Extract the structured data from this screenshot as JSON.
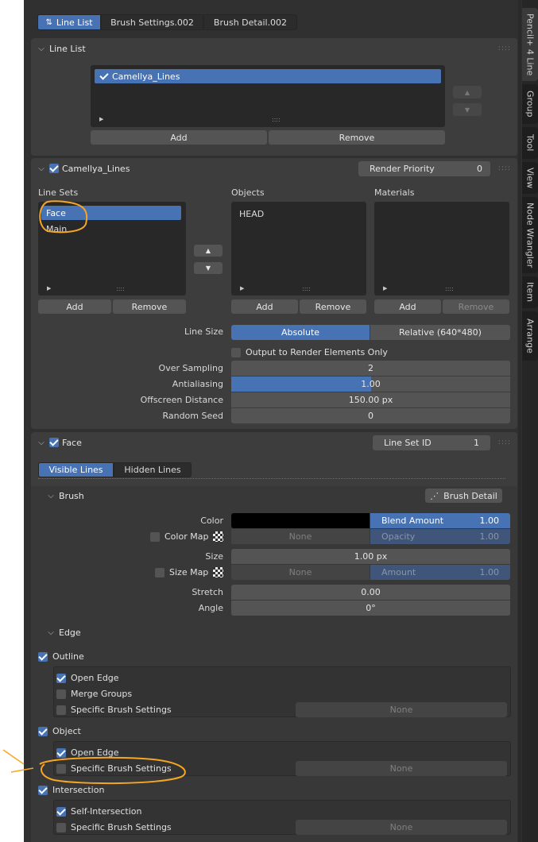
{
  "top_tabs": [
    {
      "label": "Line List",
      "active": true
    },
    {
      "label": "Brush Settings.002",
      "active": false
    },
    {
      "label": "Brush Detail.002",
      "active": false
    }
  ],
  "side_tabs": [
    "Pencil+ 4 Line",
    "Group",
    "Tool",
    "View",
    "Node Wrangler",
    "Item",
    "Arrange"
  ],
  "line_list": {
    "title": "Line List",
    "items": [
      "Camellya_Lines"
    ],
    "add": "Add",
    "remove": "Remove"
  },
  "line": {
    "title": "Camellya_Lines",
    "render_priority_label": "Render Priority",
    "render_priority_value": "0",
    "line_sets_label": "Line Sets",
    "line_sets": [
      "Face",
      "Main"
    ],
    "objects_label": "Objects",
    "objects": [
      "HEAD"
    ],
    "materials_label": "Materials",
    "add": "Add",
    "remove": "Remove",
    "line_size_label": "Line Size",
    "line_size_absolute": "Absolute",
    "line_size_relative": "Relative (640*480)",
    "output_render_elements": "Output to Render Elements Only",
    "over_sampling_label": "Over Sampling",
    "over_sampling": "2",
    "antialiasing_label": "Antialiasing",
    "antialiasing": "1.00",
    "antialiasing_fill": 0.5,
    "offscreen_label": "Offscreen Distance",
    "offscreen": "150.00 px",
    "random_seed_label": "Random Seed",
    "random_seed": "0"
  },
  "lineset": {
    "title": "Face",
    "id_label": "Line Set ID",
    "id_value": "1",
    "tabs": [
      "Visible Lines",
      "Hidden Lines"
    ],
    "brush_label": "Brush",
    "brush_detail": "Brush Detail",
    "color_label": "Color",
    "color_value": "#000000",
    "blend_amount_label": "Blend Amount",
    "blend_amount": "1.00",
    "color_map_label": "Color Map",
    "none": "None",
    "opacity_label": "Opacity",
    "opacity": "1.00",
    "size_label": "Size",
    "size": "1.00 px",
    "size_map_label": "Size Map",
    "amount_label": "Amount",
    "amount": "1.00",
    "stretch_label": "Stretch",
    "stretch": "0.00",
    "angle_label": "Angle",
    "angle": "0°",
    "edge_label": "Edge",
    "outline_label": "Outline",
    "open_edge": "Open Edge",
    "merge_groups": "Merge Groups",
    "specific_brush": "Specific Brush Settings",
    "object_label": "Object",
    "intersection_label": "Intersection",
    "self_intersection": "Self-Intersection"
  },
  "colors": {
    "accent": "#4772b3",
    "annotation": "#f5a623"
  }
}
